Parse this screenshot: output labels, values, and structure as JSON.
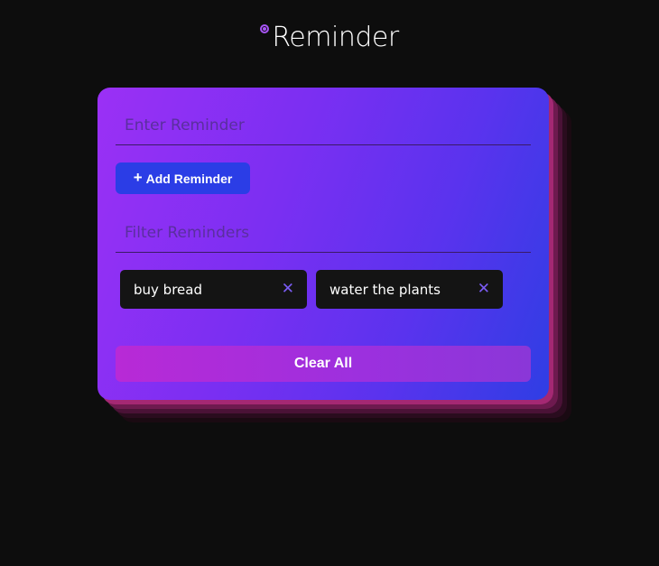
{
  "header": {
    "title": "Reminder",
    "logo_icon": "circle-dot-icon",
    "accent_color": "#a855f7"
  },
  "form": {
    "reminder_placeholder": "Enter Reminder",
    "reminder_value": "",
    "add_button_label": "Add Reminder",
    "add_button_icon": "plus-icon",
    "filter_placeholder": "Filter Reminders",
    "filter_value": ""
  },
  "reminders": [
    {
      "text": "buy bread",
      "remove_icon": "close-icon",
      "remove_glyph": "✕"
    },
    {
      "text": "water the plants",
      "remove_icon": "close-icon",
      "remove_glyph": "✕"
    }
  ],
  "actions": {
    "clear_all_label": "Clear All"
  },
  "colors": {
    "background": "#0d0d0d",
    "card_gradient_start": "#9b30f5",
    "card_gradient_end": "#2f3ee4",
    "add_button": "#2b3de6",
    "chip_background": "#141414",
    "clear_button": "#b82ad6"
  }
}
